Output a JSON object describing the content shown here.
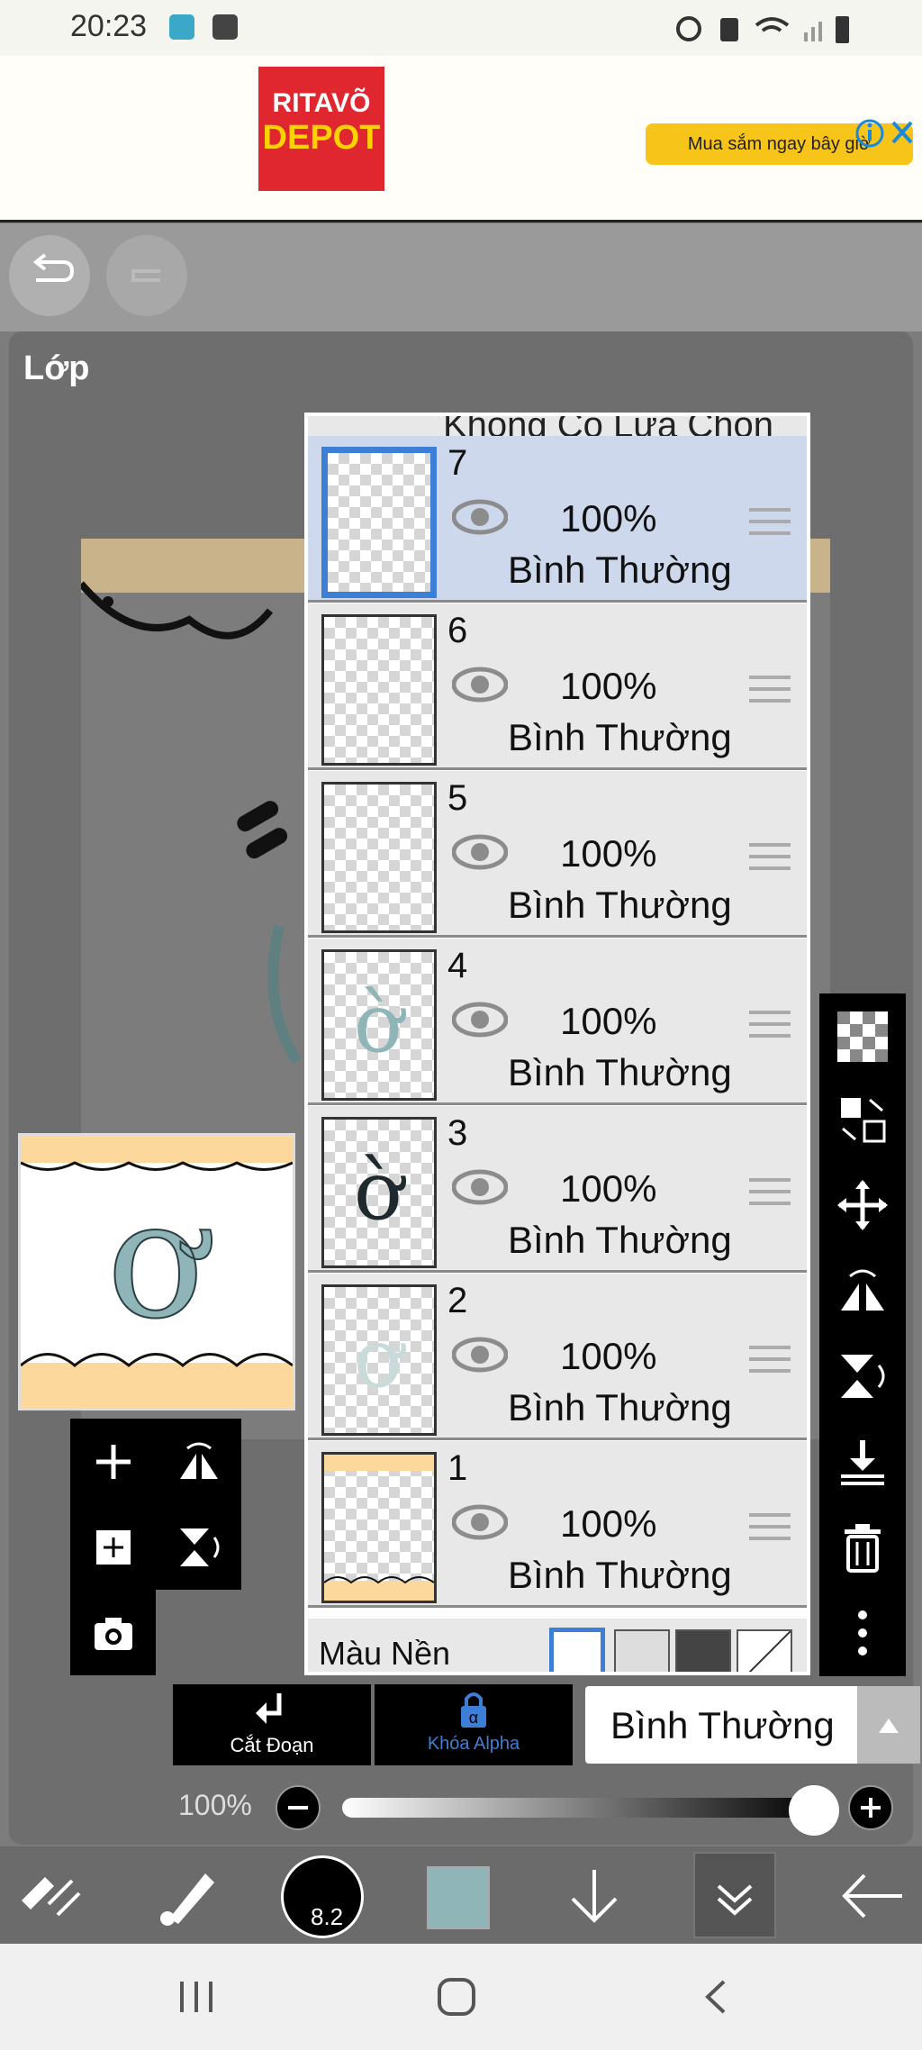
{
  "status": {
    "time": "20:23"
  },
  "ad": {
    "brand_top": "RITAVÕ",
    "brand_bottom": "DEPOT",
    "cta": "Mua sắm ngay bây giờ"
  },
  "panel": {
    "title": "Lớp",
    "partial_top_label": "Không Có Lựa Chọn"
  },
  "layers": [
    {
      "num": "7",
      "opacity": "100%",
      "mode": "Bình Thường",
      "selected": true
    },
    {
      "num": "6",
      "opacity": "100%",
      "mode": "Bình Thường",
      "selected": false
    },
    {
      "num": "5",
      "opacity": "100%",
      "mode": "Bình Thường",
      "selected": false
    },
    {
      "num": "4",
      "opacity": "100%",
      "mode": "Bình Thường",
      "selected": false
    },
    {
      "num": "3",
      "opacity": "100%",
      "mode": "Bình Thường",
      "selected": false
    },
    {
      "num": "2",
      "opacity": "100%",
      "mode": "Bình Thường",
      "selected": false
    },
    {
      "num": "1",
      "opacity": "100%",
      "mode": "Bình Thường",
      "selected": false
    }
  ],
  "background": {
    "label": "Màu Nền"
  },
  "clip": {
    "label": "Cắt Đoạn"
  },
  "alpha": {
    "label": "Khóa Alpha"
  },
  "blend": {
    "value": "Bình Thường"
  },
  "opacity_slider": {
    "label": "100%",
    "value": 1.0
  },
  "brush": {
    "size": "8.2"
  },
  "colors": {
    "accent": "#3d7fd6",
    "current_color": "#8fb5b8",
    "ad_cta": "#f7c51a",
    "ad_brand_bg": "#e0262e"
  },
  "icons": [
    "back-arrow-icon",
    "redo-icon",
    "undo-icon",
    "info-icon",
    "close-icon",
    "eye-icon",
    "drag-handle-icon",
    "transparency-icon",
    "layer-swap-icon",
    "move-icon",
    "flip-horizontal-icon",
    "flip-vertical-icon",
    "merge-down-icon",
    "trash-icon",
    "more-vertical-icon",
    "add-layer-icon",
    "copy-layer-icon",
    "camera-icon",
    "minus-icon",
    "plus-icon",
    "clip-arrow-icon",
    "alpha-lock-icon",
    "transform-icon",
    "brush-icon",
    "arrow-down-icon",
    "chevron-double-down-icon",
    "arrow-left-icon",
    "recents-icon",
    "home-icon",
    "nav-back-icon"
  ]
}
